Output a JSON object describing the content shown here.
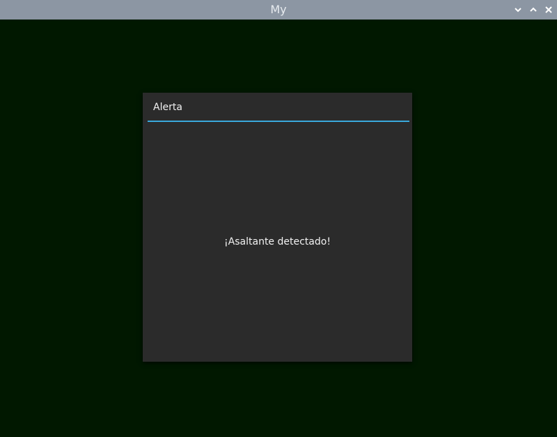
{
  "window": {
    "title": "My",
    "controls": {
      "minimize_icon": "chevron-down-icon",
      "maximize_icon": "chevron-up-icon",
      "close_icon": "close-icon"
    }
  },
  "popup": {
    "title": "Alerta",
    "message": "¡Asaltante detectado!",
    "accent_color": "#3aa9dc"
  },
  "colors": {
    "titlebar": "#8c96a3",
    "background": "#011800",
    "popup_background": "#2b2b2b"
  }
}
